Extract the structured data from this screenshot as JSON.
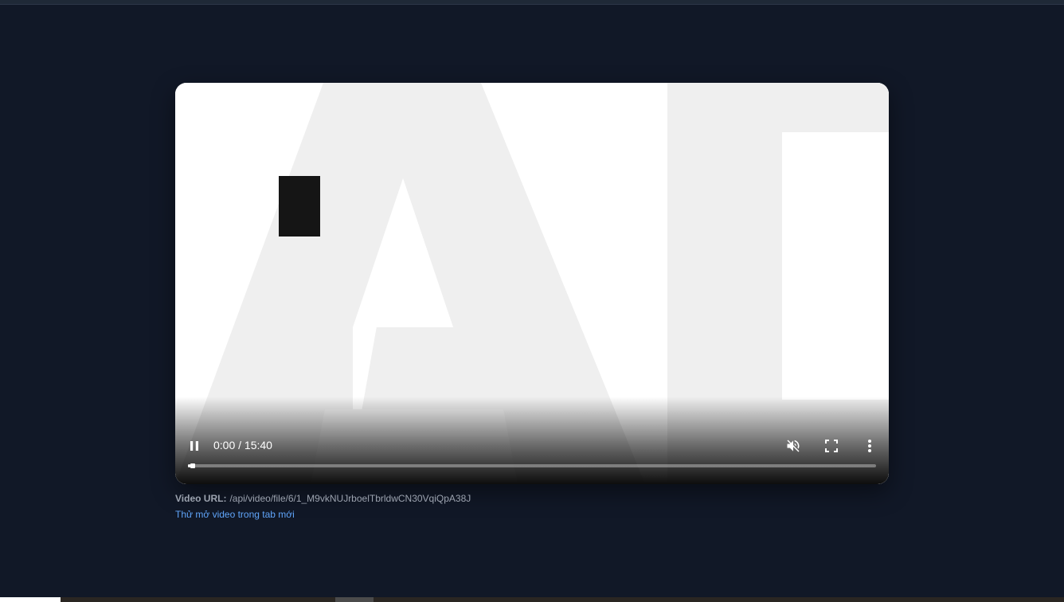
{
  "video": {
    "time_display": "0:00 / 15:40",
    "current_time": "0:00",
    "duration": "15:40",
    "progress_fraction": 0.004,
    "muted": true,
    "playing": true
  },
  "controls": {
    "play_icon": "pause-icon",
    "mute_icon": "volume-muted-icon",
    "fullscreen_icon": "fullscreen-icon",
    "more_icon": "more-vertical-icon"
  },
  "info": {
    "url_label": "Video URL:",
    "url_value": "/api/video/file/6/1_M9vkNUJrboelTbrldwCN30VqiQpA38J",
    "open_link": "Thử mở video trong tab mới"
  },
  "colors": {
    "background": "#111827",
    "link": "#60a5fa",
    "muted_text": "#9ca3af"
  }
}
